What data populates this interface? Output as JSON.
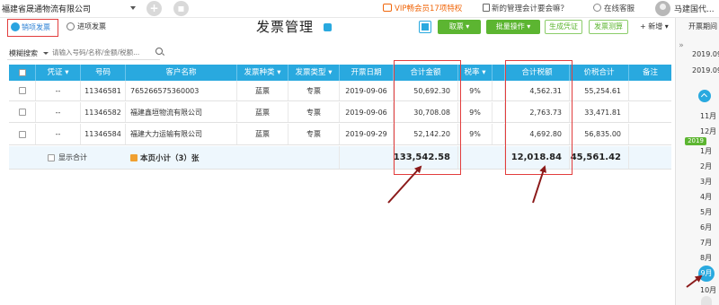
{
  "topbar": {
    "company": "福建省晟通物流有限公司",
    "vip_text": "VIP畅会员17项特权",
    "tip_text": "新的管理会计要会嘛？",
    "service_text": "在线客服",
    "user_name": "马建国代..."
  },
  "tabs": {
    "sales_label": "销项发票",
    "input_label": "进项发票"
  },
  "page_title": "发票管理",
  "toolbar": {
    "fetch_label": "取票 ▾",
    "batch_label": "批量操作 ▾",
    "voucher_label": "生成凭证",
    "calc_label": "发票测算",
    "new_label": "+ 新增 ▾"
  },
  "filter": {
    "mode_label": "模糊搜索",
    "search_placeholder": "请输入号码/名称/金额/税额..."
  },
  "table": {
    "headers": {
      "voucher": "凭证 ▾",
      "number": "号码",
      "customer": "客户名称",
      "invoice_kind": "发票种类 ▾",
      "invoice_type": "发票类型 ▾",
      "date": "开票日期",
      "amount": "合计金额",
      "tax_rate": "税率 ▾",
      "tax": "合计税额",
      "total": "价税合计",
      "note": "备注"
    },
    "rows": [
      {
        "voucher": "--",
        "number": "11346581",
        "customer": "765266575360003",
        "kind": "蓝票",
        "type": "专票",
        "date": "2019-09-06",
        "amount": "50,692.30",
        "rate": "9%",
        "tax": "4,562.31",
        "total": "55,254.61"
      },
      {
        "voucher": "--",
        "number": "11346582",
        "customer": "福建鑫垣物流有限公司",
        "kind": "蓝票",
        "type": "专票",
        "date": "2019-09-06",
        "amount": "30,708.08",
        "rate": "9%",
        "tax": "2,763.73",
        "total": "33,471.81"
      },
      {
        "voucher": "--",
        "number": "11346584",
        "customer": "福建大力运输有限公司",
        "kind": "蓝票",
        "type": "专票",
        "date": "2019-09-29",
        "amount": "52,142.20",
        "rate": "9%",
        "tax": "4,692.80",
        "total": "56,835.00"
      }
    ],
    "summary": {
      "show_total_label": "显示合计",
      "subtotal_label": "本页小计（3）张",
      "amount": "133,542.58",
      "tax": "12,018.84",
      "total": "145,561.42"
    }
  },
  "right_panel": {
    "label": "开票期间",
    "date1": "2019.09",
    "date2": "2019.09",
    "months": [
      "11月",
      "12月",
      "1月",
      "2月",
      "3月",
      "4月",
      "5月",
      "6月",
      "7月",
      "8月"
    ],
    "year_badge": "2019",
    "selected_month": "9月",
    "last_month": "10月"
  },
  "colors": {
    "accent": "#29a9df",
    "green": "#5cb531",
    "highlight": "#e23d3d",
    "arrow": "#8b1a1a"
  }
}
